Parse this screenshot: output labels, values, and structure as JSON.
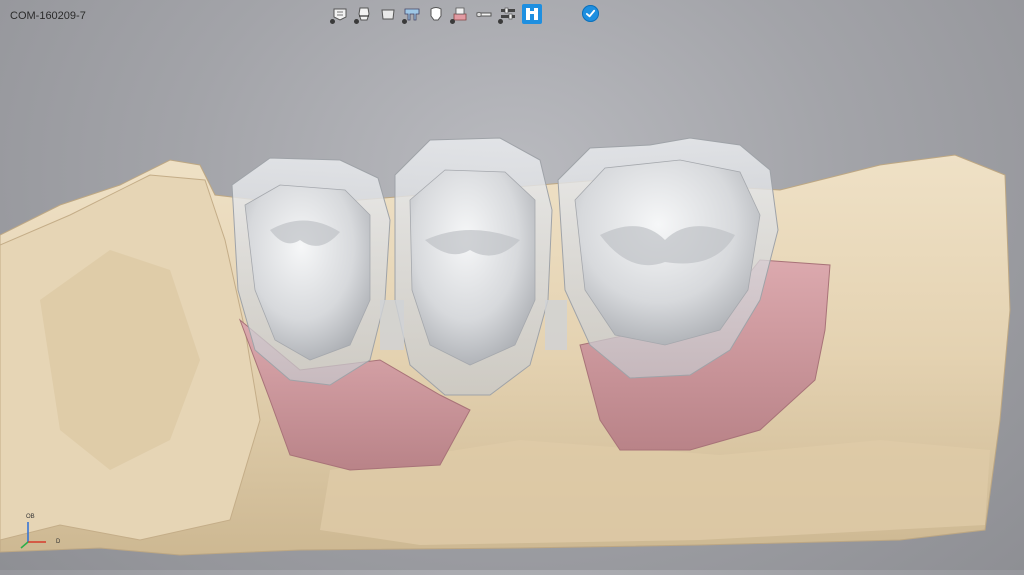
{
  "case_id": "COM-160209-7",
  "toolbar": {
    "tools": [
      {
        "name": "model-tool",
        "icon": "jaw-model-icon"
      },
      {
        "name": "margin-tool",
        "icon": "tooth-margin-icon"
      },
      {
        "name": "coping-tool",
        "icon": "coping-icon"
      },
      {
        "name": "bridge-frame-tool",
        "icon": "bridge-frame-icon"
      },
      {
        "name": "crown-tool",
        "icon": "crown-icon"
      },
      {
        "name": "gingiva-tool",
        "icon": "gingiva-icon"
      },
      {
        "name": "connector-tool",
        "icon": "connector-icon"
      },
      {
        "name": "settings-tool",
        "icon": "sliders-icon"
      },
      {
        "name": "bridge-tool",
        "icon": "bridge-active-icon",
        "active": true
      }
    ],
    "confirm_icon": "check-circle-icon"
  },
  "axis": {
    "top_label": "OB",
    "side_label": "D"
  },
  "colors": {
    "background": "#a3a4a9",
    "model": "#e8d7b8",
    "gingiva": "#c9959b",
    "crown": "#d9dbdd",
    "active_tool": "#1e8fe0"
  }
}
